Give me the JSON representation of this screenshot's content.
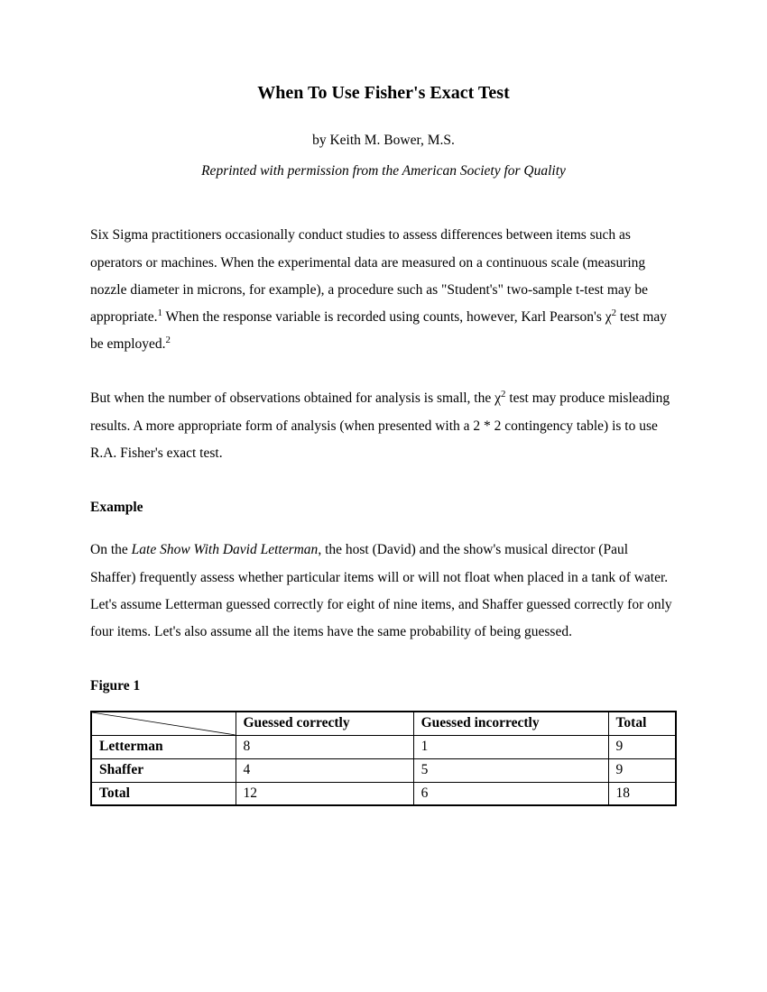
{
  "title": "When To Use Fisher's Exact Test",
  "byline": "by Keith M. Bower, M.S.",
  "reprint": "Reprinted with permission from the American Society for Quality",
  "para1_a": "Six Sigma practitioners occasionally conduct studies to assess differences between items such as operators or machines. When the experimental data are measured on a continuous scale (measuring nozzle diameter in microns, for example), a procedure such as \"Student's\" two-sample t-test may be appropriate.",
  "para1_b": " When the response variable is recorded using counts, however, Karl Pearson's ",
  "para1_c": " test may be employed.",
  "para2_a": "But when the number of observations obtained for analysis is small, the ",
  "para2_b": " test may produce misleading results. A more appropriate form of analysis (when presented with a 2 * 2 contingency table) is to use R.A. Fisher's exact test.",
  "example_head": "Example",
  "para3_a": "On the ",
  "para3_show": "Late Show With David Letterman",
  "para3_b": ", the host (David) and the show's musical director (Paul Shaffer) frequently assess whether particular items will or will not float when placed in a tank of water. Let's assume Letterman guessed correctly for eight of nine items, and Shaffer guessed correctly for only four items. Let's also assume all the items have the same probability of being guessed.",
  "figure_label": "Figure 1",
  "chi_sym": "χ",
  "fn1": "1",
  "fn2": "2",
  "sq": "2",
  "chart_data": {
    "type": "table",
    "title": "Figure 1",
    "columns": [
      "",
      "Guessed correctly",
      "Guessed incorrectly",
      "Total"
    ],
    "rows": [
      {
        "label": "Letterman",
        "correct": 8,
        "incorrect": 1,
        "total": 9
      },
      {
        "label": "Shaffer",
        "correct": 4,
        "incorrect": 5,
        "total": 9
      },
      {
        "label": "Total",
        "correct": 12,
        "incorrect": 6,
        "total": 18
      }
    ]
  }
}
